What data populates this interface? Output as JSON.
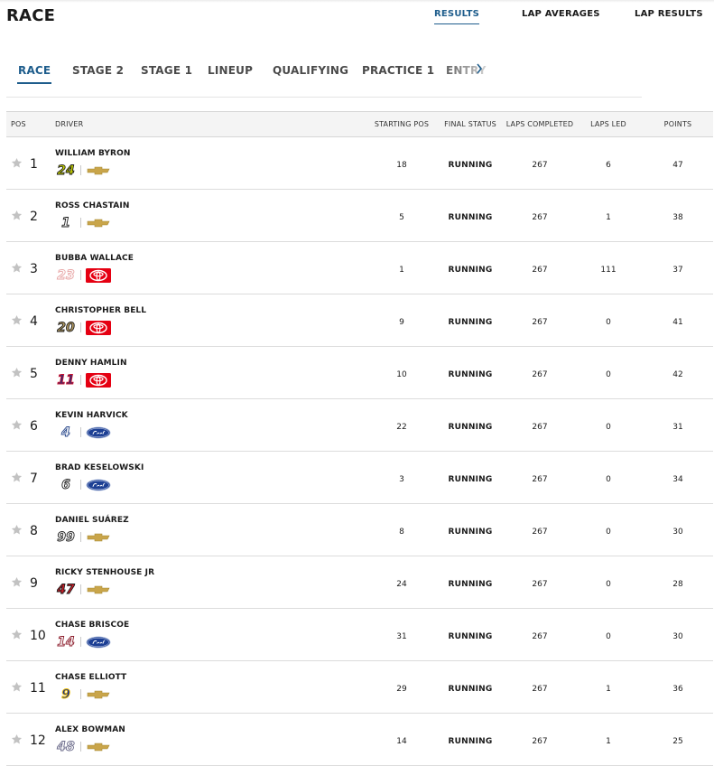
{
  "page": {
    "title": "RACE"
  },
  "top_tabs": [
    {
      "label": "RESULTS",
      "active": true
    },
    {
      "label": "LAP AVERAGES",
      "active": false
    },
    {
      "label": "LAP RESULTS",
      "active": false
    }
  ],
  "sub_tabs": [
    {
      "label": "RACE",
      "active": true
    },
    {
      "label": "STAGE 2",
      "active": false
    },
    {
      "label": "STAGE 1",
      "active": false
    },
    {
      "label": "LINEUP",
      "active": false
    },
    {
      "label": "QUALIFYING",
      "active": false
    },
    {
      "label": "PRACTICE 1",
      "active": false
    },
    {
      "label": "ENTRY",
      "active": false
    }
  ],
  "table": {
    "headers": {
      "pos": "POS",
      "driver": "DRIVER",
      "starting_pos": "STARTING POS",
      "final_status": "FINAL STATUS",
      "laps_completed": "LAPS COMPLETED",
      "laps_led": "LAPS LED",
      "points": "POINTS"
    },
    "rows": [
      {
        "pos": "1",
        "driver": "WILLIAM BYRON",
        "car_number": "24",
        "make": "chevrolet-logo",
        "number_color": "#c8d400",
        "number_stroke": "#1a1a1a",
        "starting_pos": "18",
        "final_status": "RUNNING",
        "laps_completed": "267",
        "laps_led": "6",
        "points": "47"
      },
      {
        "pos": "2",
        "driver": "ROSS CHASTAIN",
        "car_number": "1",
        "make": "chevrolet-logo",
        "number_color": "#ffffff",
        "number_stroke": "#1a1a1a",
        "starting_pos": "5",
        "final_status": "RUNNING",
        "laps_completed": "267",
        "laps_led": "1",
        "points": "38"
      },
      {
        "pos": "3",
        "driver": "BUBBA WALLACE",
        "car_number": "23",
        "make": "toyota-logo",
        "number_color": "#ffffff",
        "number_stroke": "#e8a7a7",
        "starting_pos": "1",
        "final_status": "RUNNING",
        "laps_completed": "267",
        "laps_led": "111",
        "points": "37"
      },
      {
        "pos": "4",
        "driver": "CHRISTOPHER BELL",
        "car_number": "20",
        "make": "toyota-logo",
        "number_color": "#b39a62",
        "number_stroke": "#1a1a1a",
        "starting_pos": "9",
        "final_status": "RUNNING",
        "laps_completed": "267",
        "laps_led": "0",
        "points": "41"
      },
      {
        "pos": "5",
        "driver": "DENNY HAMLIN",
        "car_number": "11",
        "make": "toyota-logo",
        "number_color": "#3a2a6e",
        "number_stroke": "#c8102e",
        "starting_pos": "10",
        "final_status": "RUNNING",
        "laps_completed": "267",
        "laps_led": "0",
        "points": "42"
      },
      {
        "pos": "6",
        "driver": "KEVIN HARVICK",
        "car_number": "4",
        "make": "ford-logo",
        "number_color": "#ffffff",
        "number_stroke": "#2b4a8c",
        "starting_pos": "22",
        "final_status": "RUNNING",
        "laps_completed": "267",
        "laps_led": "0",
        "points": "31"
      },
      {
        "pos": "7",
        "driver": "BRAD KESELOWSKI",
        "car_number": "6",
        "make": "ford-logo",
        "number_color": "#ffffff",
        "number_stroke": "#1a1a1a",
        "starting_pos": "3",
        "final_status": "RUNNING",
        "laps_completed": "267",
        "laps_led": "0",
        "points": "34"
      },
      {
        "pos": "8",
        "driver": "DANIEL SUÁREZ",
        "car_number": "99",
        "make": "chevrolet-logo",
        "number_color": "#ffffff",
        "number_stroke": "#1a1a1a",
        "starting_pos": "8",
        "final_status": "RUNNING",
        "laps_completed": "267",
        "laps_led": "0",
        "points": "30"
      },
      {
        "pos": "9",
        "driver": "RICKY STENHOUSE JR",
        "car_number": "47",
        "make": "chevrolet-logo",
        "number_color": "#d11f2a",
        "number_stroke": "#1a1a1a",
        "starting_pos": "24",
        "final_status": "RUNNING",
        "laps_completed": "267",
        "laps_led": "0",
        "points": "28"
      },
      {
        "pos": "10",
        "driver": "CHASE BRISCOE",
        "car_number": "14",
        "make": "ford-logo",
        "number_color": "#ffffff",
        "number_stroke": "#8c1d2c",
        "starting_pos": "31",
        "final_status": "RUNNING",
        "laps_completed": "267",
        "laps_led": "0",
        "points": "30"
      },
      {
        "pos": "11",
        "driver": "CHASE ELLIOTT",
        "car_number": "9",
        "make": "chevrolet-logo",
        "number_color": "#1b2f8c",
        "number_stroke": "#f2c200",
        "starting_pos": "29",
        "final_status": "RUNNING",
        "laps_completed": "267",
        "laps_led": "1",
        "points": "36"
      },
      {
        "pos": "12",
        "driver": "ALEX BOWMAN",
        "car_number": "48",
        "make": "chevrolet-logo",
        "number_color": "#ffffff",
        "number_stroke": "#6a6a8a",
        "starting_pos": "14",
        "final_status": "RUNNING",
        "laps_completed": "267",
        "laps_led": "1",
        "points": "25"
      }
    ]
  },
  "colors": {
    "accent": "#1e5d8c",
    "star": "#c2c2c2",
    "chevrolet": "#c9a54a",
    "toyota": "#e50012",
    "ford": "#1c3f94"
  }
}
